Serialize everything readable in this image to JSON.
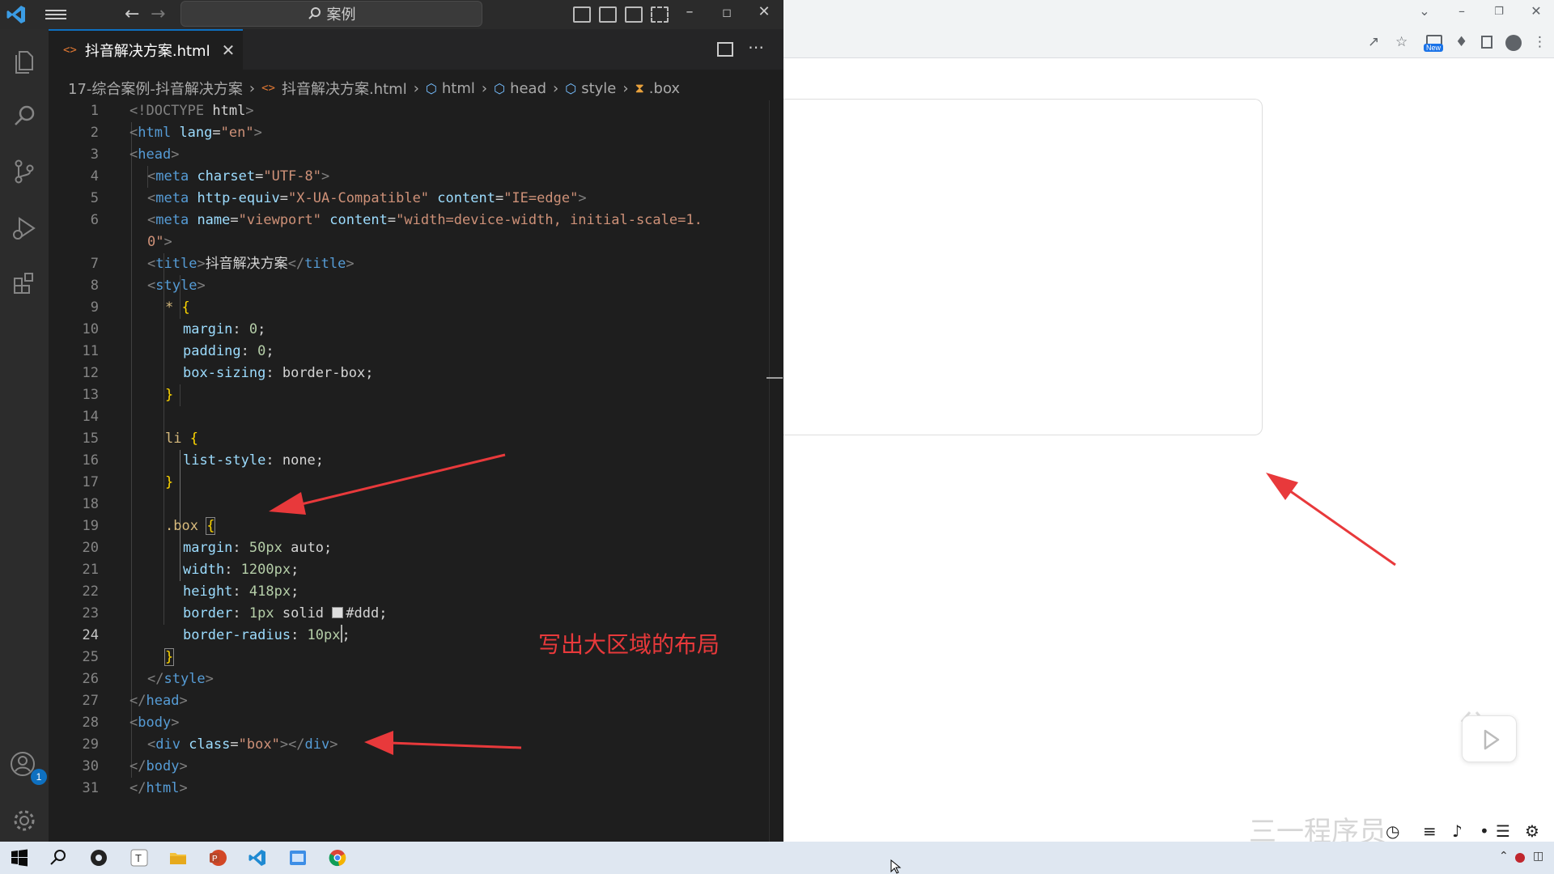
{
  "titlebar": {
    "search_text": "案例",
    "search_icon": "search-icon",
    "back_icon": "arrow-left-icon",
    "forward_icon": "arrow-right-icon"
  },
  "tab": {
    "label": "抖音解决方案.html",
    "icon": "html-file-icon"
  },
  "breadcrumb": [
    "17-综合案例-抖音解决方案",
    "抖音解决方案.html",
    "html",
    "head",
    "style",
    ".box"
  ],
  "editor": {
    "active_line": 24,
    "lines": [
      {
        "n": "1"
      },
      {
        "n": "2"
      },
      {
        "n": "3"
      },
      {
        "n": "4"
      },
      {
        "n": "5"
      },
      {
        "n": "6"
      },
      {
        "n": ""
      },
      {
        "n": "7"
      },
      {
        "n": "8"
      },
      {
        "n": "9"
      },
      {
        "n": "10"
      },
      {
        "n": "11"
      },
      {
        "n": "12"
      },
      {
        "n": "13"
      },
      {
        "n": "14"
      },
      {
        "n": "15"
      },
      {
        "n": "16"
      },
      {
        "n": "17"
      },
      {
        "n": "18"
      },
      {
        "n": "19"
      },
      {
        "n": "20"
      },
      {
        "n": "21"
      },
      {
        "n": "22"
      },
      {
        "n": "23"
      },
      {
        "n": "24"
      },
      {
        "n": "25"
      },
      {
        "n": "26"
      },
      {
        "n": "27"
      },
      {
        "n": "28"
      },
      {
        "n": "29"
      },
      {
        "n": "30"
      },
      {
        "n": "31"
      }
    ],
    "code": {
      "l1": [
        "<!DOCTYPE",
        " html",
        ">"
      ],
      "l2": [
        "<",
        "html",
        " lang",
        "=",
        "\"en\"",
        ">"
      ],
      "l3": [
        "<",
        "head",
        ">"
      ],
      "l4": [
        "<",
        "meta",
        " charset",
        "=",
        "\"UTF-8\"",
        ">"
      ],
      "l5": [
        "<",
        "meta",
        " http-equiv",
        "=",
        "\"X-UA-Compatible\"",
        " content",
        "=",
        "\"IE=edge\"",
        ">"
      ],
      "l6a": [
        "<",
        "meta",
        " name",
        "=",
        "\"viewport\"",
        " content",
        "=",
        "\"width=device-width, initial-scale=1."
      ],
      "l6b": [
        "0\"",
        ">"
      ],
      "l7": [
        "<",
        "title",
        ">",
        "抖音解决方案",
        "</",
        "title",
        ">"
      ],
      "l8": [
        "<",
        "style",
        ">"
      ],
      "l9": [
        "* ",
        "{"
      ],
      "l10": [
        "margin",
        ": ",
        "0",
        ";"
      ],
      "l11": [
        "padding",
        ": ",
        "0",
        ";"
      ],
      "l12": [
        "box-sizing",
        ": ",
        "border-box",
        ";"
      ],
      "l13": [
        "}"
      ],
      "l15": [
        "li ",
        "{"
      ],
      "l16": [
        "list-style",
        ": ",
        "none",
        ";"
      ],
      "l17": [
        "}"
      ],
      "l19": [
        ".box ",
        "{"
      ],
      "l20": [
        "margin",
        ": ",
        "50px",
        " auto",
        ";"
      ],
      "l21": [
        "width",
        ": ",
        "1200px",
        ";"
      ],
      "l22": [
        "height",
        ": ",
        "418px",
        ";"
      ],
      "l23": [
        "border",
        ": ",
        "1px",
        " solid ",
        "#ddd",
        ";"
      ],
      "l24": [
        "border-radius",
        ": ",
        "10px",
        ";"
      ],
      "l25": [
        "}"
      ],
      "l26": [
        "</",
        "style",
        ">"
      ],
      "l27": [
        "</",
        "head",
        ">"
      ],
      "l28": [
        "<",
        "body",
        ">"
      ],
      "l29": [
        "<",
        "div",
        " class",
        "=",
        "\"box\"",
        "></",
        "div",
        ">"
      ],
      "l30": [
        "</",
        "body",
        ">"
      ],
      "l31": [
        "</",
        "html",
        ">"
      ]
    }
  },
  "annotation": "写出大区域的布局",
  "activitybar": {
    "items": [
      "files-icon",
      "search-icon",
      "source-control-icon",
      "run-debug-icon",
      "extensions-icon"
    ],
    "accounts_badge": "1"
  },
  "browser": {
    "new_badge": "New",
    "watermark": "三一程序员"
  },
  "colors": {
    "accent": "#0e70c0",
    "annotation": "#e8393b",
    "box_border": "#dddddd"
  }
}
